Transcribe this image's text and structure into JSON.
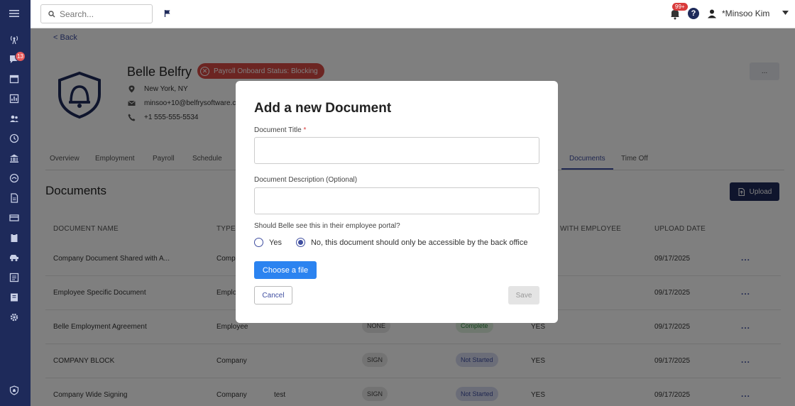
{
  "topbar": {
    "search_placeholder": "Search...",
    "notifications_badge": "99+",
    "help_label": "?",
    "user_name": "*Minsoo Kim"
  },
  "sidebar": {
    "messages_badge": "13"
  },
  "employee": {
    "back_label": "< Back",
    "name": "Belle Belfry",
    "status": "Payroll Onboard Status: Blocking",
    "location": "New York, NY",
    "email": "minsoo+10@belfrysoftware.c",
    "phone": "+1 555-555-5534",
    "more_label": "..."
  },
  "tabs": [
    "Overview",
    "Employment",
    "Payroll",
    "Schedule",
    "Documents",
    "Time Off"
  ],
  "documents": {
    "title": "Documents",
    "upload_label": "Upload",
    "columns": [
      "DOCUMENT NAME",
      "TYPE",
      "WITH EMPLOYEE",
      "UPLOAD DATE"
    ],
    "rows": [
      {
        "name": "Company Document Shared with A...",
        "type": "Comp",
        "desc": "",
        "action": "",
        "status": "",
        "shared": "",
        "date": "09/17/2025"
      },
      {
        "name": "Employee Specific Document",
        "type": "Emplo",
        "desc": "",
        "action": "",
        "status": "",
        "shared": "",
        "date": "09/17/2025"
      },
      {
        "name": "Belle Employment Agreement",
        "type": "Employee",
        "desc": "",
        "action": "NONE",
        "status": "Complete",
        "shared": "YES",
        "date": "09/17/2025"
      },
      {
        "name": "COMPANY BLOCK",
        "type": "Company",
        "desc": "",
        "action": "SIGN",
        "status": "Not Started",
        "shared": "YES",
        "date": "09/17/2025"
      },
      {
        "name": "Company Wide Signing",
        "type": "Company",
        "desc": "test",
        "action": "SIGN",
        "status": "Not Started",
        "shared": "YES",
        "date": "09/17/2025"
      }
    ]
  },
  "modal": {
    "title": "Add a new Document",
    "doc_title_label": "Document Title",
    "required_mark": "*",
    "doc_title_value": "",
    "desc_label": "Document Description (Optional)",
    "desc_value": "",
    "portal_question": "Should Belle see this in their employee portal?",
    "option_yes": "Yes",
    "option_no": "No, this document should only be accessible by the back office",
    "selected_option": "no",
    "choose_file_label": "Choose a file",
    "cancel_label": "Cancel",
    "save_label": "Save"
  },
  "colors": {
    "sidebar": "#1e2a5a",
    "accent": "#3f4ea0",
    "status_red": "#d84a45",
    "primary_button": "#2b83f0"
  }
}
